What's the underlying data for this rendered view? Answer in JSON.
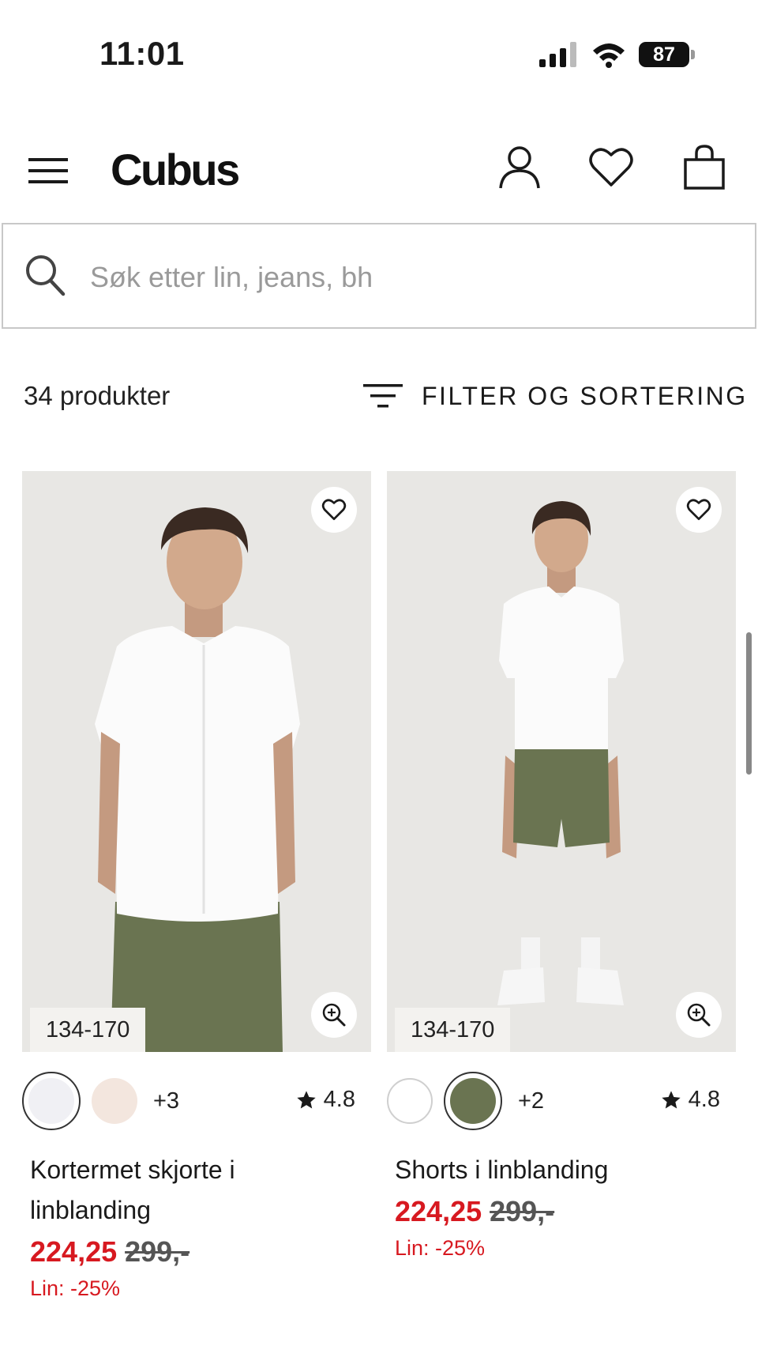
{
  "status_bar": {
    "time": "11:01",
    "battery": "87"
  },
  "header": {
    "logo": "Cubus"
  },
  "search": {
    "placeholder": "Søk etter lin, jeans, bh"
  },
  "toolbar": {
    "count_label": "34 produkter",
    "filter_label": "FILTER OG SORTERING"
  },
  "products": [
    {
      "size_range": "134-170",
      "swatch_colors": [
        "#f0f0f4",
        "#f3e6de"
      ],
      "selected_swatch": 0,
      "more_colors": "+3",
      "rating": "4.8",
      "name": "Kortermet skjorte i linblanding",
      "price_sale": "224,25",
      "price_original": "299,-",
      "promo": "Lin: -25%"
    },
    {
      "size_range": "134-170",
      "swatch_colors": [
        "#ffffff",
        "#6a7451"
      ],
      "selected_swatch": 1,
      "more_colors": "+2",
      "rating": "4.8",
      "name": "Shorts i linblanding",
      "price_sale": "224,25",
      "price_original": "299,-",
      "promo": "Lin: -25%"
    }
  ],
  "colors": {
    "sale": "#d71920",
    "image_bg": "#e8e7e4",
    "shorts": "#6a7451",
    "shirt": "#fbfbfb"
  }
}
